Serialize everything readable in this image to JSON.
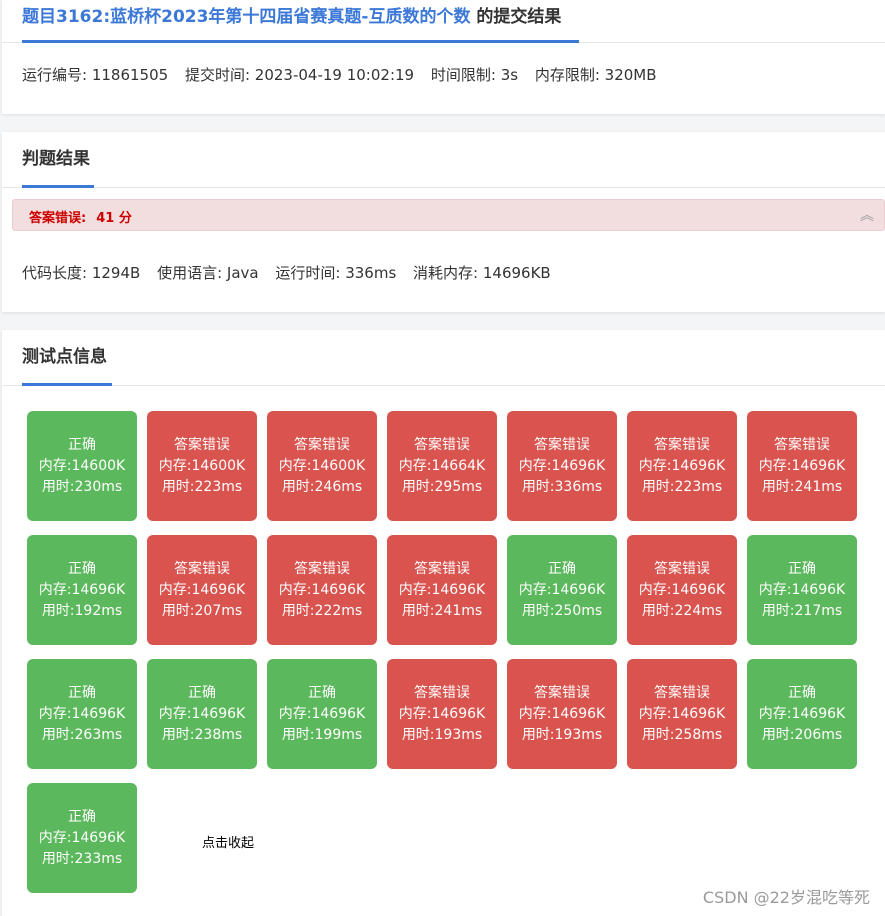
{
  "submission": {
    "problem_title": "题目3162:蓝桥杯2023年第十四届省赛真题-互质数的个数",
    "title_suffix": "的提交结果",
    "run_id": "运行编号: 11861505",
    "submit_time": "提交时间: 2023-04-19 10:02:19",
    "time_limit": "时间限制: 3s",
    "memory_limit": "内存限制: 320MB"
  },
  "judge": {
    "heading": "判题结果",
    "status": "答案错误:",
    "score": "41 分",
    "code_length": "代码长度: 1294B",
    "language": "使用语言: Java",
    "run_time": "运行时间: 336ms",
    "memory_used": "消耗内存: 14696KB"
  },
  "tests": {
    "heading": "测试点信息",
    "collapse_label": "点击收起",
    "cases": [
      {
        "status": "正确",
        "memory": "内存:14600K",
        "time": "用时:230ms",
        "ok": true
      },
      {
        "status": "答案错误",
        "memory": "内存:14600K",
        "time": "用时:223ms",
        "ok": false
      },
      {
        "status": "答案错误",
        "memory": "内存:14600K",
        "time": "用时:246ms",
        "ok": false
      },
      {
        "status": "答案错误",
        "memory": "内存:14664K",
        "time": "用时:295ms",
        "ok": false
      },
      {
        "status": "答案错误",
        "memory": "内存:14696K",
        "time": "用时:336ms",
        "ok": false
      },
      {
        "status": "答案错误",
        "memory": "内存:14696K",
        "time": "用时:223ms",
        "ok": false
      },
      {
        "status": "答案错误",
        "memory": "内存:14696K",
        "time": "用时:241ms",
        "ok": false
      },
      {
        "status": "正确",
        "memory": "内存:14696K",
        "time": "用时:192ms",
        "ok": true
      },
      {
        "status": "答案错误",
        "memory": "内存:14696K",
        "time": "用时:207ms",
        "ok": false
      },
      {
        "status": "答案错误",
        "memory": "内存:14696K",
        "time": "用时:222ms",
        "ok": false
      },
      {
        "status": "答案错误",
        "memory": "内存:14696K",
        "time": "用时:241ms",
        "ok": false
      },
      {
        "status": "正确",
        "memory": "内存:14696K",
        "time": "用时:250ms",
        "ok": true
      },
      {
        "status": "答案错误",
        "memory": "内存:14696K",
        "time": "用时:224ms",
        "ok": false
      },
      {
        "status": "正确",
        "memory": "内存:14696K",
        "time": "用时:217ms",
        "ok": true
      },
      {
        "status": "正确",
        "memory": "内存:14696K",
        "time": "用时:263ms",
        "ok": true
      },
      {
        "status": "正确",
        "memory": "内存:14696K",
        "time": "用时:238ms",
        "ok": true
      },
      {
        "status": "正确",
        "memory": "内存:14696K",
        "time": "用时:199ms",
        "ok": true
      },
      {
        "status": "答案错误",
        "memory": "内存:14696K",
        "time": "用时:193ms",
        "ok": false
      },
      {
        "status": "答案错误",
        "memory": "内存:14696K",
        "time": "用时:193ms",
        "ok": false
      },
      {
        "status": "答案错误",
        "memory": "内存:14696K",
        "time": "用时:258ms",
        "ok": false
      },
      {
        "status": "正确",
        "memory": "内存:14696K",
        "time": "用时:206ms",
        "ok": true
      },
      {
        "status": "正确",
        "memory": "内存:14696K",
        "time": "用时:233ms",
        "ok": true
      }
    ]
  },
  "watermark": "CSDN @22岁混吃等死",
  "colors": {
    "accent": "#3c78d8",
    "correct": "#5cb85c",
    "wrong": "#d9534f",
    "error_bar": "#f2dede",
    "error_text": "#cc0000"
  }
}
